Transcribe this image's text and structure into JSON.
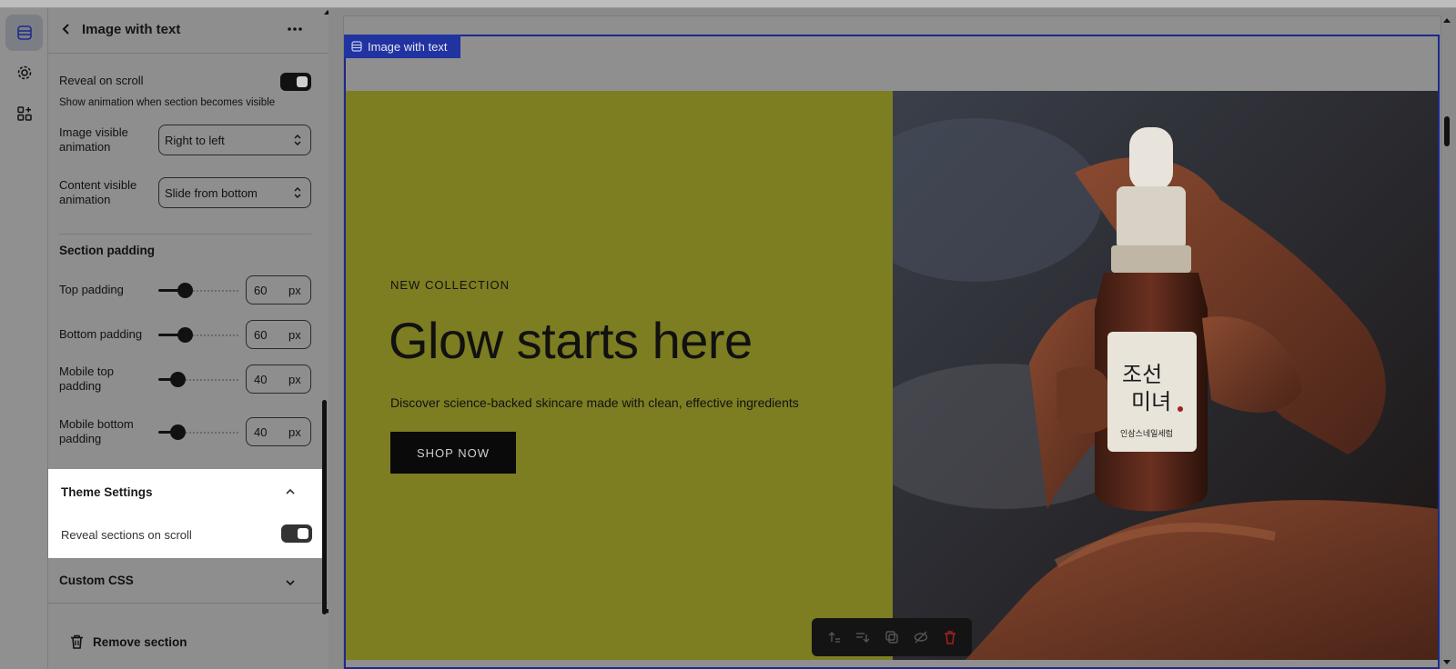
{
  "panel": {
    "title": "Image with text",
    "reveal_on_scroll_label": "Reveal on scroll",
    "reveal_on_scroll_enabled": true,
    "reveal_help": "Show animation when section becomes visible",
    "image_anim_label_1": "Image visible",
    "image_anim_label_2": "animation",
    "image_anim_value": "Right to left",
    "content_anim_label_1": "Content visible",
    "content_anim_label_2": "animation",
    "content_anim_value": "Slide from bottom",
    "padding_title": "Section padding",
    "paddings": [
      {
        "label1": "Top padding",
        "label2": "",
        "value": "60",
        "unit": "px"
      },
      {
        "label1": "Bottom padding",
        "label2": "",
        "value": "60",
        "unit": "px"
      },
      {
        "label1": "Mobile top",
        "label2": "padding",
        "value": "40",
        "unit": "px"
      },
      {
        "label1": "Mobile bottom",
        "label2": "padding",
        "value": "40",
        "unit": "px"
      }
    ],
    "theme_settings": {
      "title": "Theme Settings",
      "reveal_label": "Reveal sections on scroll",
      "reveal_enabled": true
    },
    "custom_css_title": "Custom CSS",
    "remove_label": "Remove section"
  },
  "preview": {
    "section_tag": "Image with text",
    "eyebrow": "NEW COLLECTION",
    "headline": "Glow starts here",
    "subline": "Discover science-backed skincare made with clean, effective ingredients",
    "button": "SHOP NOW",
    "bottle_label_line1": "조선",
    "bottle_label_line2": "미녀",
    "bottle_small": "인삼스네일세럼",
    "colors": {
      "olive": "#7d7d22",
      "accent": "#2133a0"
    }
  },
  "icons": {
    "rail": [
      "sections-icon",
      "settings-gear-icon",
      "apps-icon"
    ],
    "toolbar": [
      "move-up-icon",
      "move-down-icon",
      "duplicate-icon",
      "hide-icon",
      "delete-icon"
    ]
  }
}
